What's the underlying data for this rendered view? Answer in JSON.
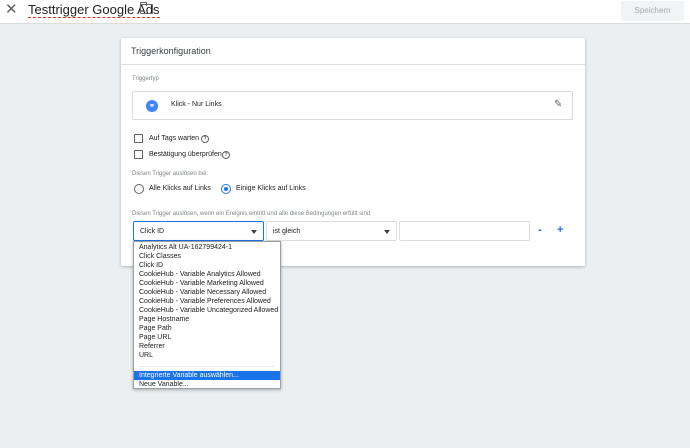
{
  "topbar": {
    "title": "Testtrigger Google Ads",
    "save_label": "Speichern"
  },
  "card": {
    "header": "Triggerkonfiguration",
    "trigger_type_label": "Triggertyp",
    "trigger_type_value": "Klick - Nur Links",
    "wait_for_tags": "Auf Tags warten",
    "check_validation": "Bestätigung überprüfen",
    "fire_on_label": "Diesen Trigger auslösen bei:",
    "fire_all": "Alle Klicks auf Links",
    "fire_some": "Einige Klicks auf Links",
    "condition_label": "Diesen Trigger auslösen, wenn ein Ereignis eintritt und alle diese Bedingungen erfüllt sind",
    "variable_value": "Click ID",
    "operator_value": "ist gleich",
    "minus": "-",
    "plus": "+"
  },
  "dropdown": {
    "items": [
      "Analytics Alt UA-162799424-1",
      "Click Classes",
      "Click ID",
      "CookieHub - Variable Analytics Allowed",
      "CookieHub - Variable Marketing Allowed",
      "CookieHub - Variable Necessary Allowed",
      "CookieHub - Variable Preferences Allowed",
      "CookieHub - Variable Uncategorized Allowed",
      "Page Hostname",
      "Page Path",
      "Page URL",
      "Referrer",
      "URL"
    ],
    "builtin": "Integrierte Variable auswählen...",
    "new_variable": "Neue Variable..."
  },
  "icons": {
    "close": "close-icon",
    "folder": "folder-icon",
    "trigger_type": "link-icon",
    "edit": "pencil-icon",
    "help": "help-icon"
  },
  "colors": {
    "accent": "#1a73e8",
    "background": "#eceff1",
    "icon_blue": "#4285f4"
  }
}
